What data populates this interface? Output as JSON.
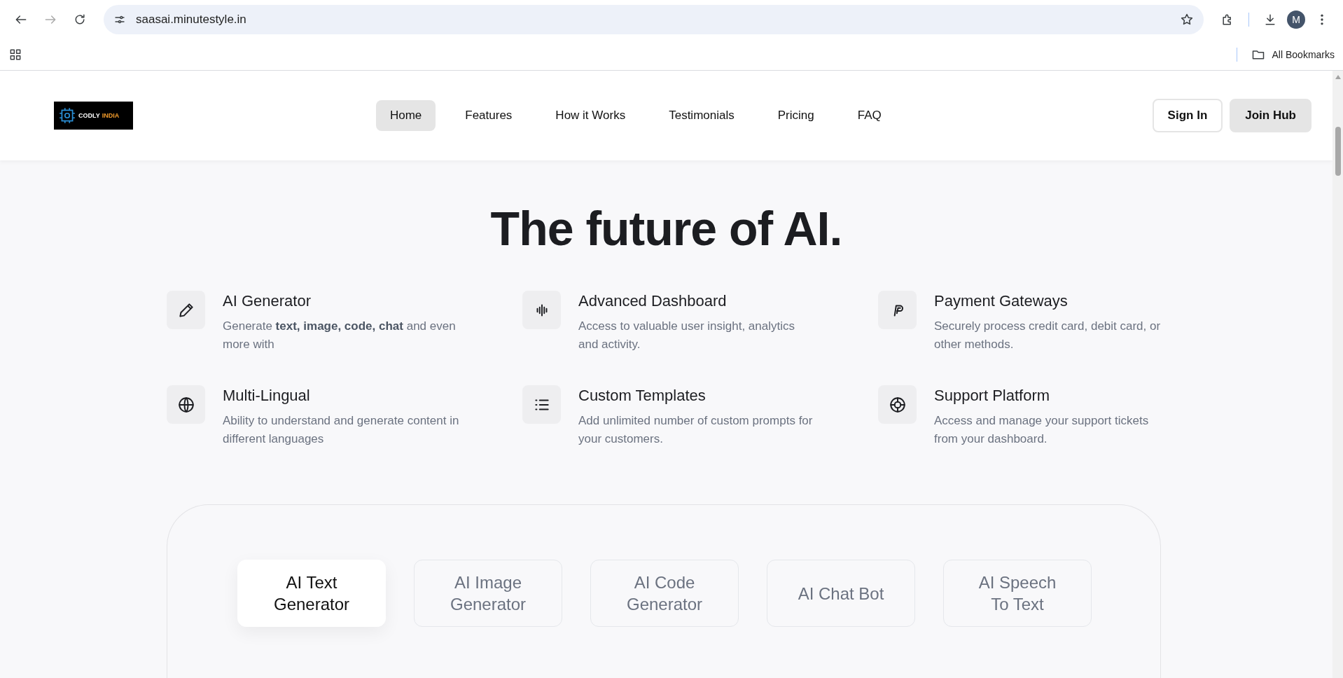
{
  "browser": {
    "url": "saasai.minutestyle.in",
    "avatar_initial": "M",
    "bookmarks_label": "All Bookmarks"
  },
  "header": {
    "logo": {
      "part_1": "CODLY",
      "part_2": "INDIA"
    },
    "nav_links": [
      {
        "label": "Home",
        "selected": true
      },
      {
        "label": "Features",
        "selected": false
      },
      {
        "label": "How it Works",
        "selected": false
      },
      {
        "label": "Testimonials",
        "selected": false
      },
      {
        "label": "Pricing",
        "selected": false
      },
      {
        "label": "FAQ",
        "selected": false
      }
    ],
    "buttons": [
      {
        "label": "Sign In",
        "kind": "outline"
      },
      {
        "label": "Join Hub",
        "kind": "filled"
      }
    ]
  },
  "hero": {
    "title": "The future of AI."
  },
  "features": [
    {
      "title": "AI Generator",
      "description": "Generate **text, image, code, chat** and even more with"
    },
    {
      "title": "Advanced Dashboard",
      "description": "Access to valuable user insight, analytics and activity."
    },
    {
      "title": "Payment Gateways",
      "description": "Securely process credit card, debit card, or other methods."
    },
    {
      "title": "Multi-Lingual",
      "description": "Ability to understand and generate content in different languages"
    },
    {
      "title": "Custom Templates",
      "description": "Add unlimited number of custom prompts for your customers."
    },
    {
      "title": "Support Platform",
      "description": "Access and manage your support tickets from your dashboard."
    }
  ],
  "tool_tabs": [
    {
      "label": "AI Text Generator",
      "selected": true
    },
    {
      "label": "AI Image Generator",
      "selected": false
    },
    {
      "label": "AI Code Generator",
      "selected": false
    },
    {
      "label": "AI Chat Bot",
      "selected": false
    },
    {
      "label": "AI Speech To Text",
      "selected": false
    }
  ]
}
